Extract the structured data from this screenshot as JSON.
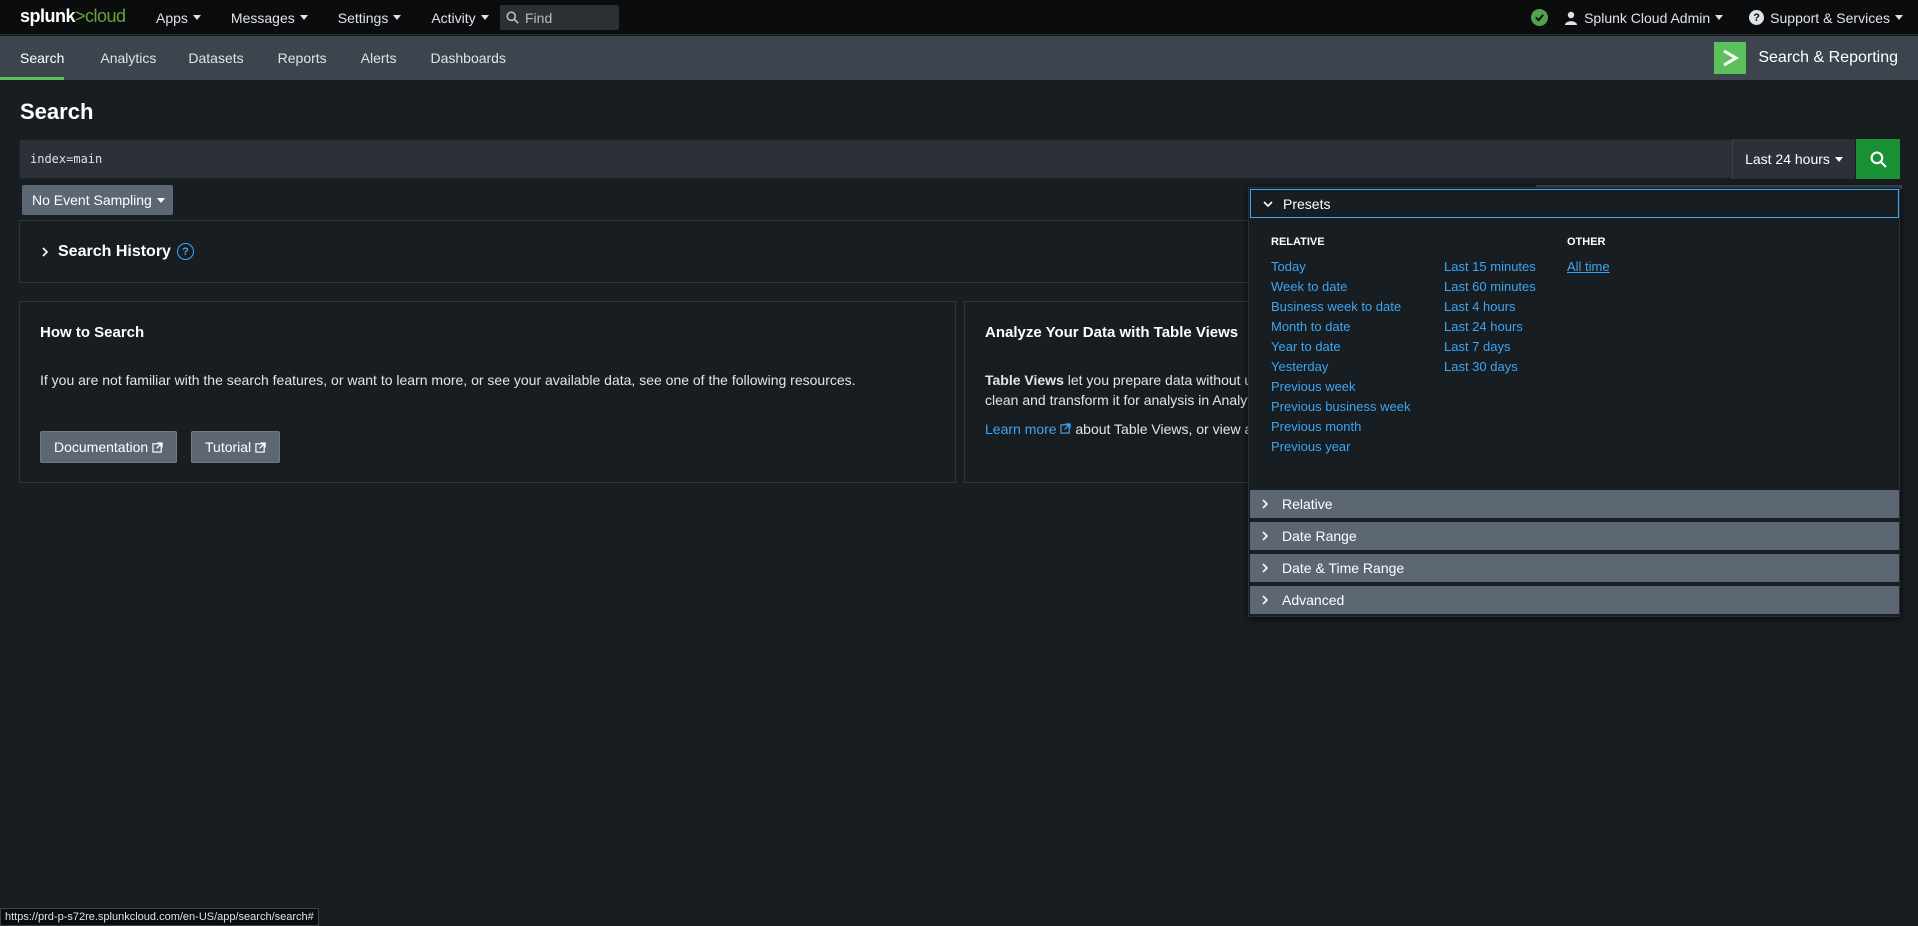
{
  "topbar": {
    "logo_main": "splunk",
    "logo_sep": ">",
    "logo_suffix": "cloud",
    "nav": [
      "Apps",
      "Messages",
      "Settings",
      "Activity"
    ],
    "find_placeholder": "Find",
    "user": "Splunk Cloud Admin",
    "support": "Support & Services"
  },
  "appbar": {
    "tabs": [
      "Search",
      "Analytics",
      "Datasets",
      "Reports",
      "Alerts",
      "Dashboards"
    ],
    "active_tab": "Search",
    "app_title": "Search & Reporting"
  },
  "page": {
    "title": "Search",
    "query": "index=main",
    "time_range": "Last 24 hours",
    "sampling": "No Event Sampling"
  },
  "history": {
    "title": "Search History",
    "help": "?"
  },
  "how_to": {
    "title": "How to Search",
    "text": "If you are not familiar with the search features, or want to learn more, or see your available data, see one of the following resources.",
    "doc_button": "Documentation",
    "tutorial_button": "Tutorial"
  },
  "table_views": {
    "title": "Analyze Your Data with Table Views",
    "line1_bold": "Table Views",
    "line1_rest": " let you prepare data without u",
    "line2": "clean and transform it for analysis in Analyt",
    "learn_more": "Learn more",
    "line3_rest": " about Table Views, or view a"
  },
  "presets": {
    "header": "Presets",
    "relative_header": "RELATIVE",
    "relative_col1": [
      "Today",
      "Week to date",
      "Business week to date",
      "Month to date",
      "Year to date",
      "Yesterday",
      "Previous week",
      "Previous business week",
      "Previous month",
      "Previous year"
    ],
    "relative_col2": [
      "Last 15 minutes",
      "Last 60 minutes",
      "Last 4 hours",
      "Last 24 hours",
      "Last 7 days",
      "Last 30 days"
    ],
    "other_header": "OTHER",
    "other": [
      "All time"
    ]
  },
  "accordions": [
    "Relative",
    "Date Range",
    "Date & Time Range",
    "Advanced"
  ],
  "statusbar": "https://prd-p-s72re.splunkcloud.com/en-US/app/search/search#",
  "colors": {
    "accent_green": "#5cc05c",
    "search_button": "#1a9035",
    "link_blue": "#3ea5f2",
    "panel_gray": "#5c6773"
  }
}
